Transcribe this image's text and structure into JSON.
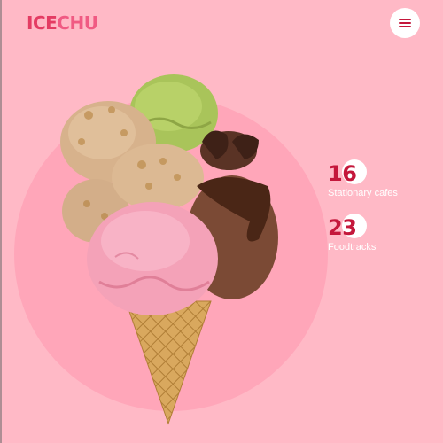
{
  "brand": {
    "logo_part1": "ICE",
    "logo_part2": "CHU"
  },
  "header": {
    "menu_icon": "hamburger-menu-icon"
  },
  "stats": [
    {
      "value": "16",
      "label": "Stationary cafes"
    },
    {
      "value": "23",
      "label": "Foodtracks"
    }
  ],
  "colors": {
    "background": "#ffb9c6",
    "circle": "#ffa6b9",
    "brand": "#e43c63",
    "accent_text": "#c4173b"
  },
  "hero": {
    "image": "ice-cream-cone-illustration"
  }
}
